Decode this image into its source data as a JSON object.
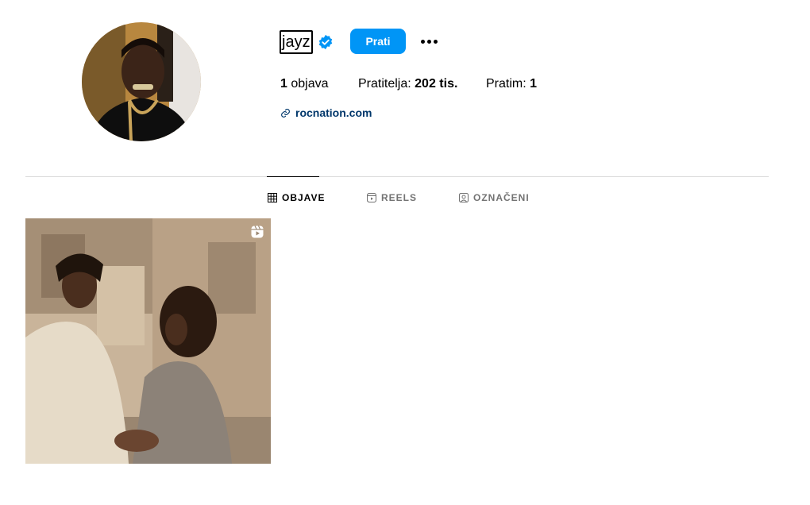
{
  "profile": {
    "username": "jayz",
    "verified": true,
    "follow_label": "Prati",
    "more_label": "...",
    "stats": {
      "posts_count": "1",
      "posts_label": "objava",
      "followers_label": "Pratitelja:",
      "followers_count": "202 tis.",
      "following_label": "Pratim:",
      "following_count": "1"
    },
    "link": "rocnation.com"
  },
  "tabs": [
    {
      "label": "OBJAVE",
      "active": true
    },
    {
      "label": "REELS",
      "active": false
    },
    {
      "label": "OZNAČENI",
      "active": false
    }
  ],
  "posts": [
    {
      "type": "reel",
      "icon": "reel-icon"
    }
  ],
  "colors": {
    "accent": "#0095f6",
    "verified": "#0095f6",
    "link": "#00376b",
    "divider": "#dbdbdb",
    "muted": "#737373"
  }
}
